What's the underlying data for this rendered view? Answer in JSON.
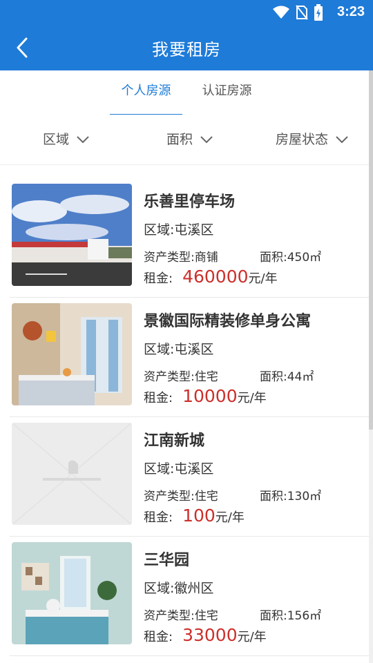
{
  "status": {
    "time": "3:23"
  },
  "header": {
    "title": "我要租房"
  },
  "tabs": [
    {
      "label": "个人房源",
      "active": true
    },
    {
      "label": "认证房源",
      "active": false
    }
  ],
  "filters": [
    {
      "label": "区域"
    },
    {
      "label": "面积"
    },
    {
      "label": "房屋状态"
    }
  ],
  "listings": [
    {
      "title": "乐善里停车场",
      "region": "区域:屯溪区",
      "type": "资产类型:商铺",
      "area": "面积:450㎡",
      "rent_label": "租金:",
      "rent_value": "460000",
      "rent_unit": "元/年",
      "image": "commercial-building"
    },
    {
      "title": "景徽国际精装修单身公寓",
      "region": "区域:屯溪区",
      "type": "资产类型:住宅",
      "area": "面积:44㎡",
      "rent_label": "租金:",
      "rent_value": "10000",
      "rent_unit": "元/年",
      "image": "bedroom"
    },
    {
      "title": "江南新城",
      "region": "区域:屯溪区",
      "type": "资产类型:住宅",
      "area": "面积:130㎡",
      "rent_label": "租金:",
      "rent_value": "100",
      "rent_unit": "元/年",
      "image": "placeholder"
    },
    {
      "title": "三华园",
      "region": "区域:徽州区",
      "type": "资产类型:住宅",
      "area": "面积:156㎡",
      "rent_label": "租金:",
      "rent_value": "33000",
      "rent_unit": "元/年",
      "image": "bedroom"
    }
  ],
  "colors": {
    "primary": "#1e7bd8",
    "price": "#cc2f2a"
  }
}
